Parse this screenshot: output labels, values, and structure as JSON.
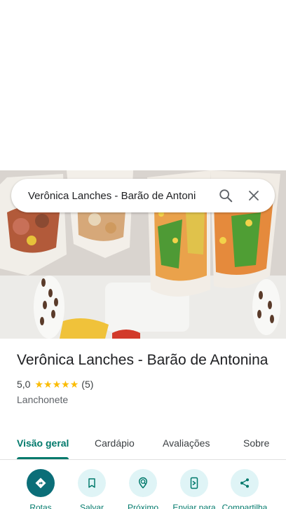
{
  "search": {
    "query": "Verônica Lanches - Barão de Antoni",
    "search_icon": "search-icon",
    "close_icon": "close-icon"
  },
  "place": {
    "name": "Verônica Lanches - Barão de Antonina",
    "rating": "5,0",
    "stars": 5,
    "review_count": "(5)",
    "category": "Lanchonete"
  },
  "tabs": [
    {
      "label": "Visão geral",
      "active": true
    },
    {
      "label": "Cardápio"
    },
    {
      "label": "Avaliações"
    },
    {
      "label": "Sobre"
    }
  ],
  "actions": [
    {
      "label": "Rotas",
      "icon": "directions-icon"
    },
    {
      "label": "Salvar",
      "icon": "bookmark-icon"
    },
    {
      "label": "Próximo",
      "icon": "nearby-icon"
    },
    {
      "label": "Enviar para",
      "icon": "send-to-phone-icon"
    },
    {
      "label": "Compartilha",
      "icon": "share-icon"
    }
  ],
  "colors": {
    "accent": "#00796b",
    "primary_action": "#0b6e78",
    "action_bg": "#dff4f6",
    "star": "#fbbc04"
  }
}
